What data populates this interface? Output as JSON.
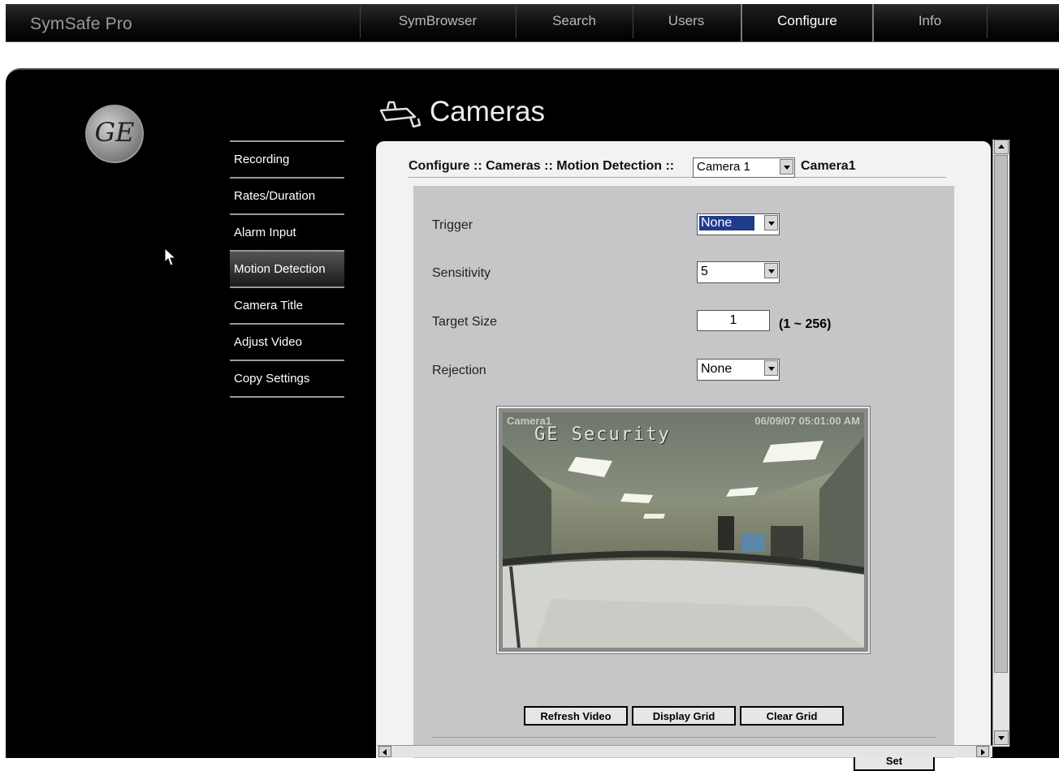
{
  "app": {
    "title": "SymSafe Pro"
  },
  "nav": {
    "tabs": [
      "SymBrowser",
      "Search",
      "Users",
      "Configure",
      "Info"
    ],
    "active": "Configure"
  },
  "page": {
    "title": "Cameras"
  },
  "sidebar": {
    "items": [
      "Recording",
      "Rates/Duration",
      "Alarm Input",
      "Motion Detection",
      "Camera Title",
      "Adjust Video",
      "Copy Settings"
    ],
    "active": "Motion Detection"
  },
  "breadcrumb": {
    "text": "Configure :: Cameras :: Motion Detection ::",
    "camera_select_value": "Camera 1",
    "camera_name": "Camera1"
  },
  "form": {
    "trigger": {
      "label": "Trigger",
      "value": "None"
    },
    "sensitivity": {
      "label": "Sensitivity",
      "value": "5"
    },
    "target_size": {
      "label": "Target Size",
      "value": "1",
      "range": "(1 ~ 256)"
    },
    "rejection": {
      "label": "Rejection",
      "value": "None"
    }
  },
  "video": {
    "camera_label": "Camera1",
    "timestamp": "06/09/07 05:01:00 AM",
    "brand_overlay": "GE Security"
  },
  "buttons": {
    "refresh_video": "Refresh Video",
    "display_grid": "Display Grid",
    "clear_grid": "Clear Grid",
    "set": "Set"
  },
  "logo": {
    "text": "GE"
  },
  "colors": {
    "nav_bg": "#000000",
    "panel_bg": "#000000",
    "content_bg": "#f2f2f2",
    "form_bg": "#c6c6c8",
    "selection": "#203a8c"
  }
}
